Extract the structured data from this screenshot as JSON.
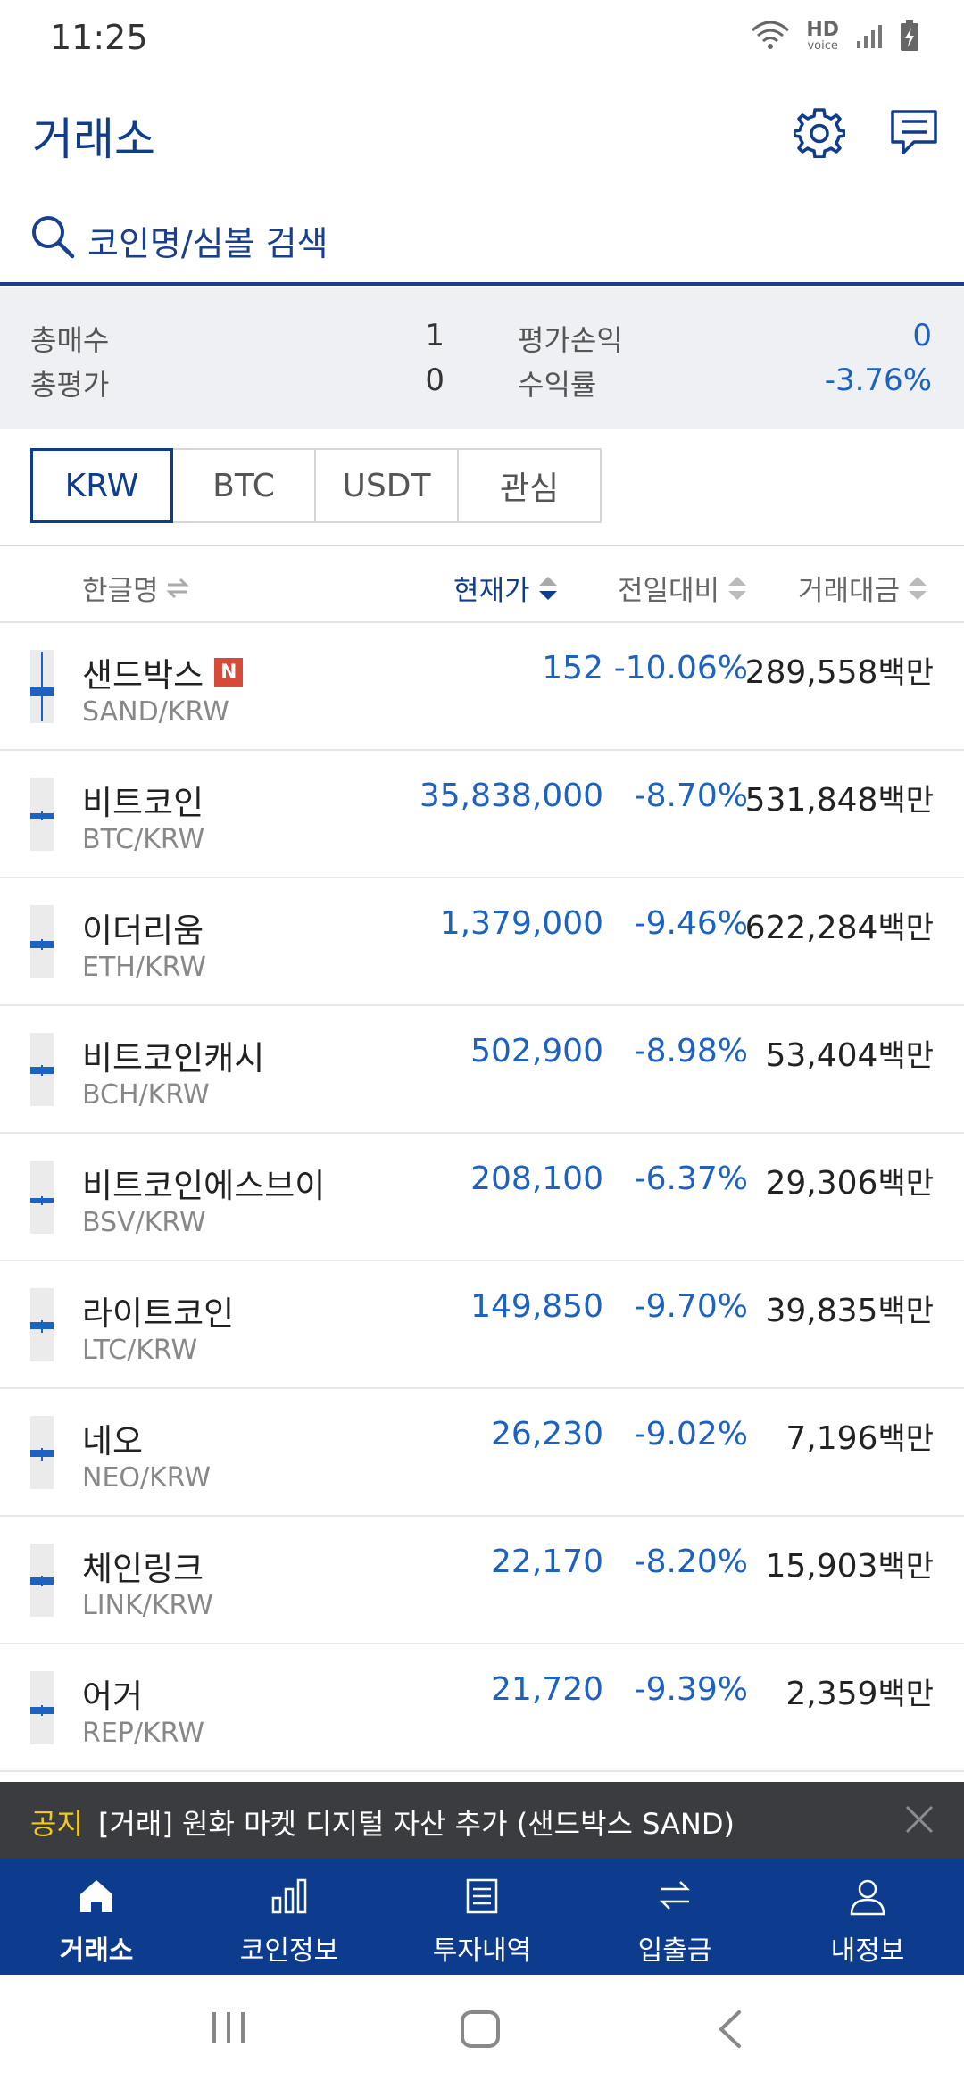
{
  "status_bar": {
    "time": "11:25",
    "hd_text": "HD",
    "voice_text": "voice"
  },
  "header": {
    "title": "거래소",
    "settings_icon": "gear-icon",
    "chat_icon": "chat-icon"
  },
  "search": {
    "placeholder": "코인명/심볼 검색"
  },
  "summary": {
    "total_buy_label": "총매수",
    "total_buy_value": "1",
    "total_eval_label": "총평가",
    "total_eval_value": "0",
    "pnl_label": "평가손익",
    "pnl_value": "0",
    "return_label": "수익률",
    "return_value": "-3.76%",
    "accent_color": "#1e62c1"
  },
  "tabs": [
    "KRW",
    "BTC",
    "USDT",
    "관심"
  ],
  "active_tab": "KRW",
  "columns": {
    "name": "한글명",
    "price": "현재가",
    "change": "전일대비",
    "volume": "거래대금"
  },
  "coins": [
    {
      "name": "샌드박스",
      "is_new": true,
      "new_badge": "N",
      "symbol": "SAND/KRW",
      "price": "152",
      "change": "-10.06%",
      "volume": "289,558",
      "unit": "백만"
    },
    {
      "name": "비트코인",
      "symbol": "BTC/KRW",
      "price": "35,838,000",
      "change": "-8.70%",
      "volume": "531,848",
      "unit": "백만"
    },
    {
      "name": "이더리움",
      "symbol": "ETH/KRW",
      "price": "1,379,000",
      "change": "-9.46%",
      "volume": "622,284",
      "unit": "백만"
    },
    {
      "name": "비트코인캐시",
      "symbol": "BCH/KRW",
      "price": "502,900",
      "change": "-8.98%",
      "volume": "53,404",
      "unit": "백만"
    },
    {
      "name": "비트코인에스브이",
      "symbol": "BSV/KRW",
      "price": "208,100",
      "change": "-6.37%",
      "volume": "29,306",
      "unit": "백만"
    },
    {
      "name": "라이트코인",
      "symbol": "LTC/KRW",
      "price": "149,850",
      "change": "-9.70%",
      "volume": "39,835",
      "unit": "백만"
    },
    {
      "name": "네오",
      "symbol": "NEO/KRW",
      "price": "26,230",
      "change": "-9.02%",
      "volume": "7,196",
      "unit": "백만"
    },
    {
      "name": "체인링크",
      "symbol": "LINK/KRW",
      "price": "22,170",
      "change": "-8.20%",
      "volume": "15,903",
      "unit": "백만"
    },
    {
      "name": "어거",
      "symbol": "REP/KRW",
      "price": "21,720",
      "change": "-9.39%",
      "volume": "2,359",
      "unit": "백만"
    }
  ],
  "notice": {
    "tag": "공지",
    "text": "[거래] 원화 마켓 디지털 자산 추가 (샌드박스 SAND)"
  },
  "bottom_nav": [
    {
      "label": "거래소",
      "icon": "home-icon",
      "active": true
    },
    {
      "label": "코인정보",
      "icon": "bar-chart-icon",
      "active": false
    },
    {
      "label": "투자내역",
      "icon": "document-icon",
      "active": false
    },
    {
      "label": "입출금",
      "icon": "transfer-icon",
      "active": false
    },
    {
      "label": "내정보",
      "icon": "person-icon",
      "active": false
    }
  ],
  "colors": {
    "brand": "#103c8c",
    "nav_background": "#0d3c8e",
    "down": "#1e62c1",
    "new_badge": "#d64a3a",
    "notice_tag": "#f2c81e"
  }
}
